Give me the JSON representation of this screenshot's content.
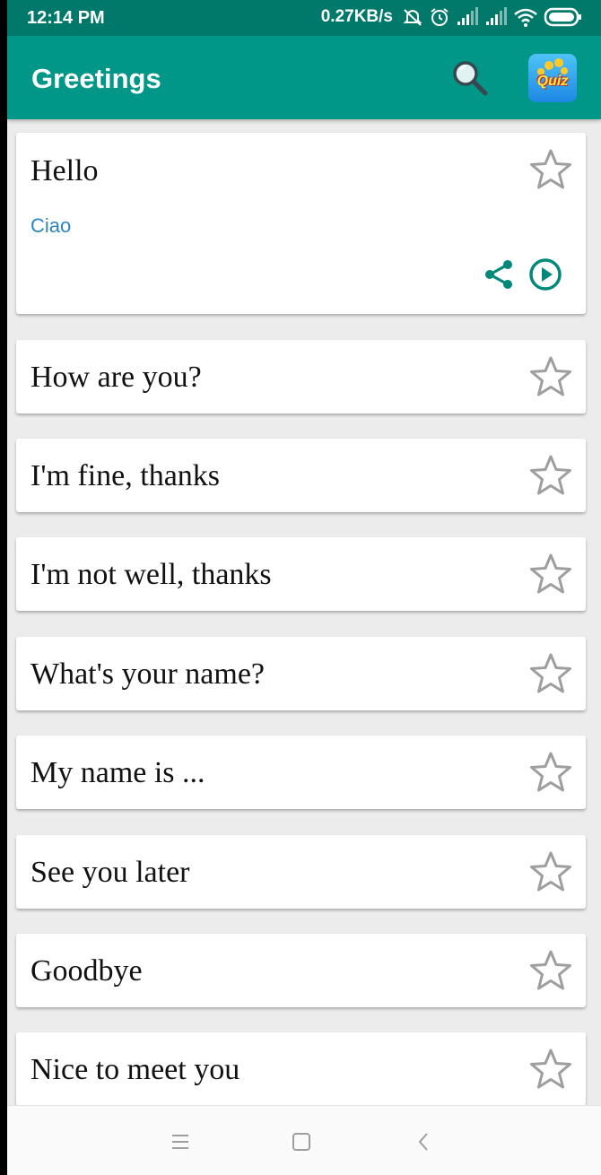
{
  "status_bar": {
    "time": "12:14 PM",
    "network_speed": "0.27KB/s",
    "icons": [
      "mute-icon",
      "alarm-icon",
      "signal-icon",
      "signal-icon",
      "wifi-icon",
      "battery-icon"
    ]
  },
  "app_bar": {
    "title": "Greetings",
    "search_icon": "search-icon",
    "quiz_label": "Quiz"
  },
  "colors": {
    "status_bar": "#00796b",
    "app_bar": "#009688",
    "accent": "#00897b",
    "translation": "#2e86c1",
    "star": "#9e9e9e"
  },
  "phrases": [
    {
      "text": "Hello",
      "translation": "Ciao",
      "expanded": true
    },
    {
      "text": "How are you?"
    },
    {
      "text": "I'm fine, thanks"
    },
    {
      "text": "I'm not well, thanks"
    },
    {
      "text": "What's your name?"
    },
    {
      "text": "My name is ..."
    },
    {
      "text": "See you later"
    },
    {
      "text": "Goodbye"
    },
    {
      "text": "Nice to meet you"
    }
  ],
  "nav_bar": {
    "icons": [
      "menu-icon",
      "home-icon",
      "back-icon"
    ]
  }
}
